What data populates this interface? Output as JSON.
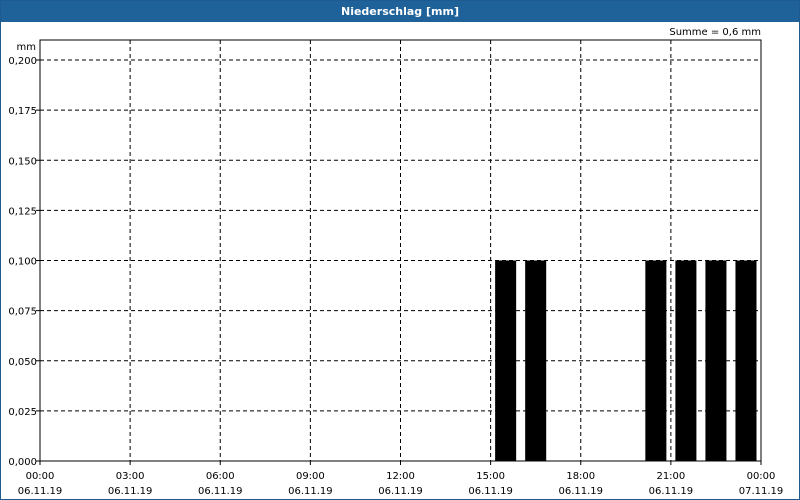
{
  "window": {
    "title": "Niederschlag [mm]"
  },
  "chart_data": {
    "type": "bar",
    "title": "Niederschlag [mm]",
    "ylabel": "mm",
    "annotation": "Summe = 0,6 mm",
    "ylim": [
      0,
      0.2
    ],
    "y_ticks": [
      "0,000",
      "0,025",
      "0,050",
      "0,075",
      "0,100",
      "0,125",
      "0,150",
      "0,175",
      "0,200"
    ],
    "x_ticks": [
      {
        "time": "00:00",
        "date": "06.11.19"
      },
      {
        "time": "03:00",
        "date": "06.11.19"
      },
      {
        "time": "06:00",
        "date": "06.11.19"
      },
      {
        "time": "09:00",
        "date": "06.11.19"
      },
      {
        "time": "12:00",
        "date": "06.11.19"
      },
      {
        "time": "15:00",
        "date": "06.11.19"
      },
      {
        "time": "18:00",
        "date": "06.11.19"
      },
      {
        "time": "21:00",
        "date": "06.11.19"
      },
      {
        "time": "00:00",
        "date": "07.11.19"
      }
    ],
    "xlim": [
      "06.11.19 00:00",
      "07.11.19 00:00"
    ],
    "x": [
      "15:30",
      "16:30",
      "20:30",
      "21:30",
      "22:30",
      "23:30"
    ],
    "values": [
      0.1,
      0.1,
      0.1,
      0.1,
      0.1,
      0.1
    ],
    "bar_color": "#000000",
    "grid": true
  }
}
